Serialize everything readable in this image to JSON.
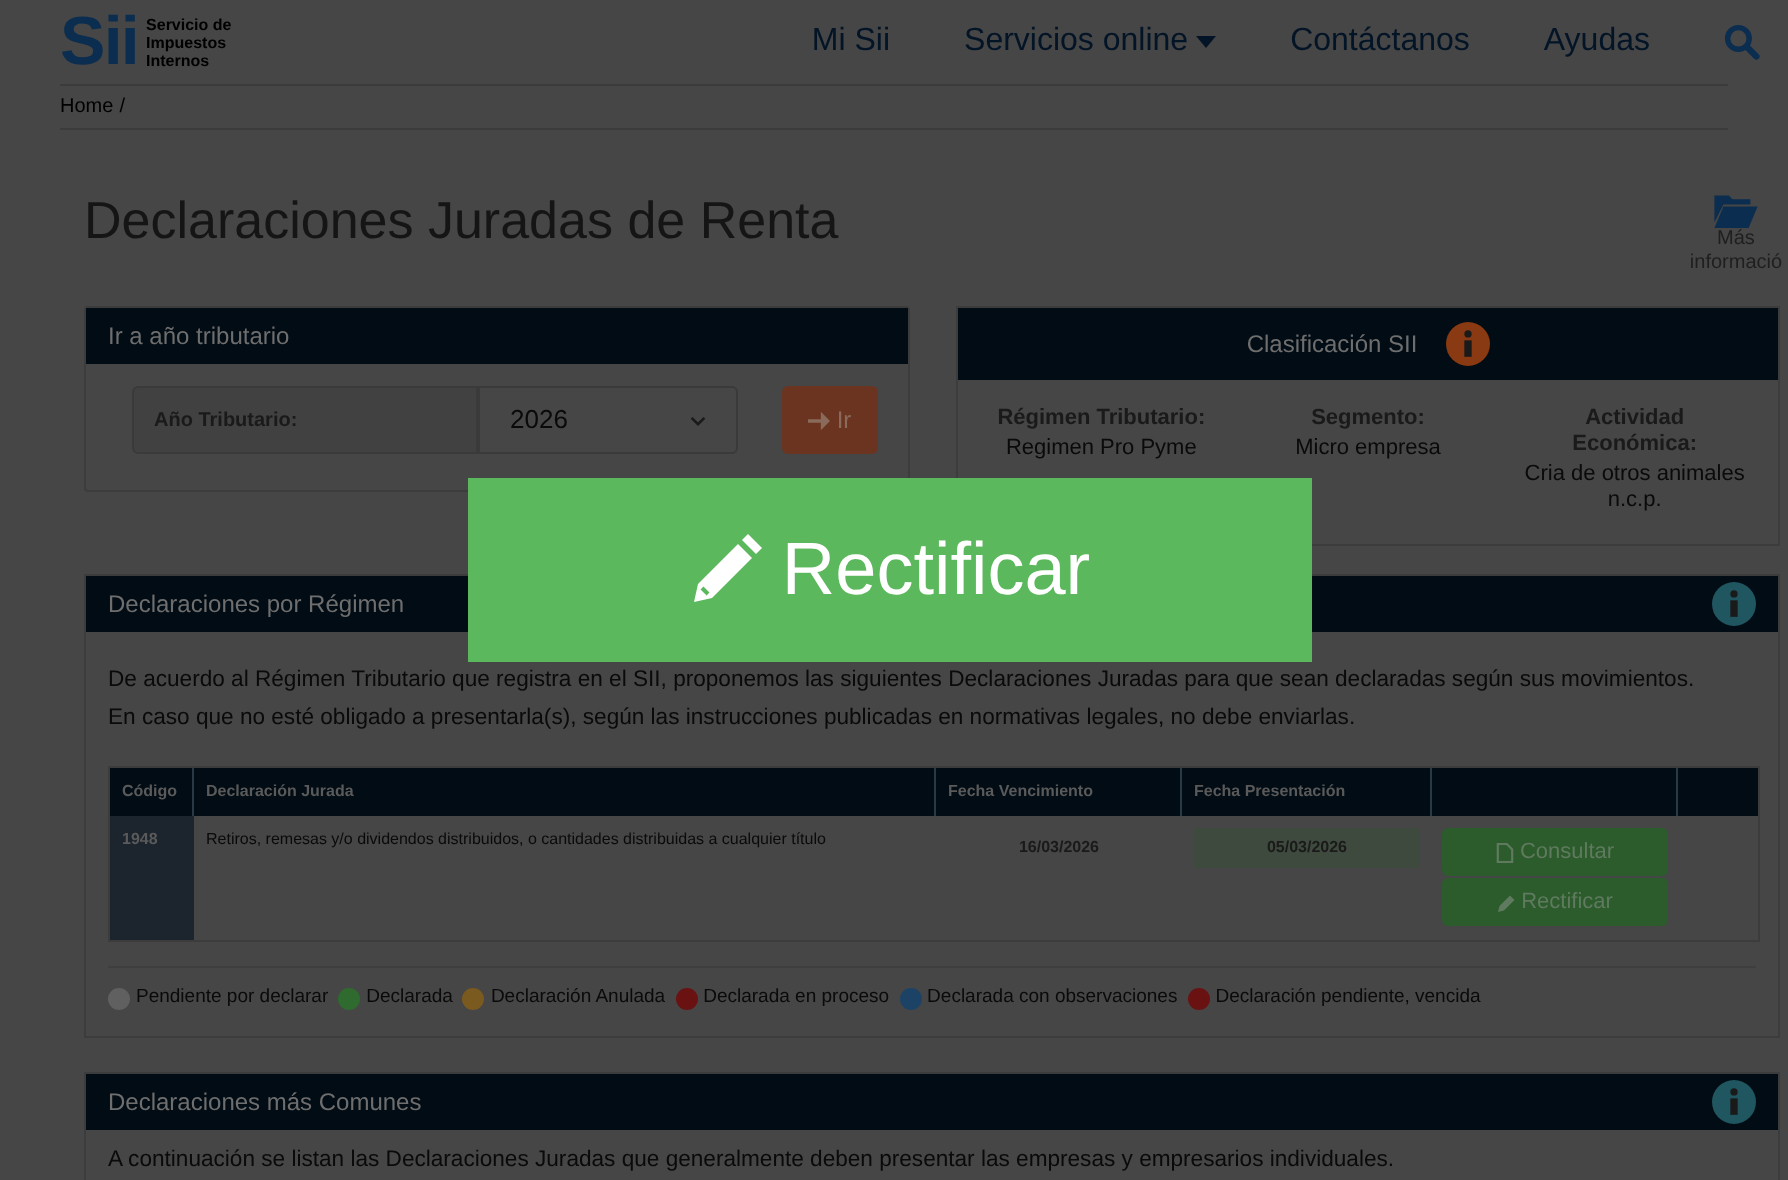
{
  "header": {
    "logo_text": "Sii",
    "logo_subtitle": [
      "Servicio de",
      "Impuestos",
      "Internos"
    ],
    "nav": [
      {
        "label": "Mi Sii",
        "dropdown": false
      },
      {
        "label": "Servicios online",
        "dropdown": true
      },
      {
        "label": "Contáctanos",
        "dropdown": false
      },
      {
        "label": "Ayudas",
        "dropdown": false
      }
    ]
  },
  "breadcrumb": [
    "Home",
    "/"
  ],
  "title": "Declaraciones Juradas de Renta",
  "more_info": [
    "Más",
    "informació"
  ],
  "year_panel": {
    "title": "Ir a año tributario",
    "label": "Año Tributario:",
    "value": "2026",
    "button": "Ir"
  },
  "classification": {
    "title": "Clasificación SII",
    "fields": [
      {
        "label": "Régimen Tributario:",
        "value": "Regimen Pro Pyme"
      },
      {
        "label": "Segmento:",
        "value": "Micro empresa"
      },
      {
        "label": "Actividad Económica:",
        "value": "Cria de otros animales n.c.p."
      }
    ]
  },
  "regime_section": {
    "title": "Declaraciones por Régimen",
    "paragraphs": [
      "De acuerdo al Régimen Tributario que registra en el SII, proponemos las siguientes Declaraciones Juradas para que sean declaradas según sus movimientos.",
      "En caso que no esté obligado a presentarla(s), según las instrucciones publicadas en normativas legales, no debe enviarlas."
    ],
    "table": {
      "columns": [
        "Código",
        "Declaración Jurada",
        "Fecha Vencimiento",
        "Fecha Presentación"
      ],
      "rows": [
        {
          "code": "1948",
          "name": "Retiros, remesas y/o dividendos distribuidos, o cantidades distribuidas a cualquier título",
          "due": "16/03/2026",
          "submitted": "05/03/2026",
          "actions": [
            "Consultar",
            "Rectificar"
          ]
        }
      ]
    },
    "legend": [
      {
        "label": "Pendiente por declarar",
        "color": "#606060"
      },
      {
        "label": "Declarada",
        "color": "#2f6b2f"
      },
      {
        "label": "Declaración Anulada",
        "color": "#7a5a1e"
      },
      {
        "label": "Declarada en proceso",
        "color": "#6a1212"
      },
      {
        "label": "Declarada con observaciones",
        "color": "#1c4366"
      },
      {
        "label": "Declaración pendiente, vencida",
        "color": "#6a1212"
      }
    ]
  },
  "common_section": {
    "title": "Declaraciones más Comunes",
    "paragraph": "A continuación se listan las Declaraciones Juradas que generalmente deben presentar las empresas y empresarios individuales."
  },
  "highlight_button": "Rectificar"
}
